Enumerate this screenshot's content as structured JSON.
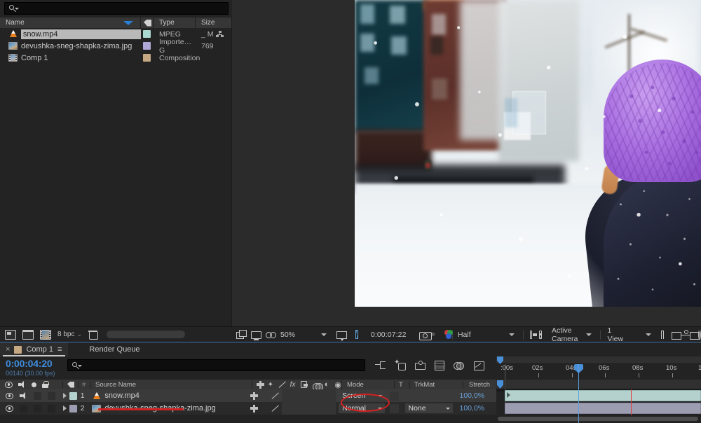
{
  "app": "Adobe After Effects",
  "project_panel": {
    "search_placeholder": "",
    "columns": {
      "name": "Name",
      "type": "Type",
      "size": "Size"
    },
    "items": [
      {
        "name": "snow.mp4",
        "type": "MPEG",
        "size": "_ M",
        "icon": "vlc-media-icon",
        "swatch": "#a8d8cf",
        "selected": true
      },
      {
        "name": "devushka-sneg-shapka-zima.jpg",
        "type": "Importe…G",
        "size": "769",
        "icon": "image-file-icon",
        "swatch": "#b0a8d8",
        "selected": false
      },
      {
        "name": "Comp 1",
        "type": "Composition",
        "size": "",
        "icon": "composition-icon",
        "swatch": "#c6a882",
        "selected": false
      }
    ],
    "footer": {
      "bit_depth": "8 bpc"
    }
  },
  "viewer_bar": {
    "zoom": "50%",
    "timecode": "0:00:07:22",
    "resolution": "Half",
    "camera": "Active Camera",
    "views": "1 View"
  },
  "timeline": {
    "tabs": [
      {
        "label": "Comp 1",
        "active": true
      },
      {
        "label": "Render Queue",
        "active": false
      }
    ],
    "current_time": "0:00:04:20",
    "frame_info": "00140 (30.00 fps)",
    "search_placeholder": "",
    "columns": {
      "source_name": "Source Name",
      "mode": "Mode",
      "t": "T",
      "trkmat": "TrkMat",
      "stretch": "Stretch",
      "number": "#"
    },
    "ruler_labels": [
      ":00s",
      "02s",
      "04s",
      "06s",
      "08s",
      "10s"
    ],
    "layers": [
      {
        "index": "1",
        "name": "snow.mp4",
        "mode": "Screen",
        "trkmat": "",
        "stretch": "100,0%",
        "swatch": "#b5d1cd",
        "icon": "vlc-media-icon",
        "audio": true,
        "annotated": true
      },
      {
        "index": "2",
        "name": "devushka-sneg-shapka-zima.jpg",
        "mode": "Normal",
        "trkmat": "None",
        "stretch": "100,0%",
        "swatch": "#9d9db2",
        "icon": "image-file-icon",
        "audio": false,
        "annotated": false
      }
    ]
  },
  "annotations": {
    "mode_highlight": "Screen dropdown circled in red",
    "layer_highlight": "snow.mp4 layer underlined in red",
    "color": "#d42020"
  }
}
